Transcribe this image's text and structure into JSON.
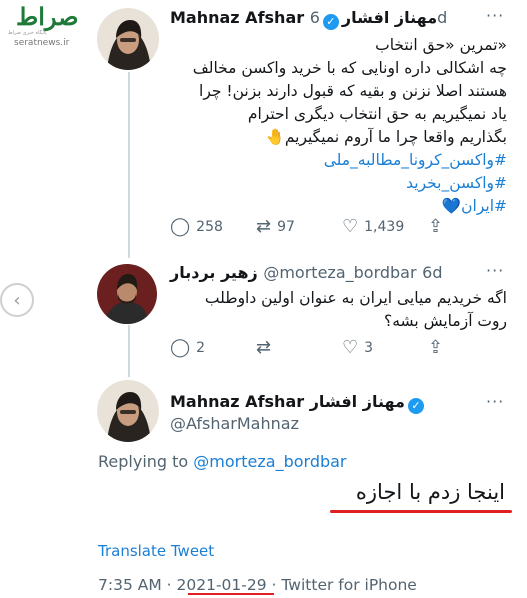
{
  "watermark": {
    "logo": "صراط",
    "tagline": "پایگاه خبری صراط",
    "site": "seratnews.ir"
  },
  "icons": {
    "prev": "chevron-left-icon",
    "reply": "reply-icon",
    "retweet": "retweet-icon",
    "like": "heart-icon",
    "share": "share-icon"
  },
  "colors": {
    "link": "#1b7fd4",
    "verified": "#1d9bf0",
    "highlight": "#e02020"
  },
  "tweet1": {
    "name_en": "Mahnaz Afshar",
    "name_fa": "مهناز افشار",
    "time": "6d",
    "lines": [
      "«تمرین «حق انتخاب",
      "چه اشکالی داره اونایی که با خرید واکسن مخالف",
      "هستند اصلا نزنن و بقیه که قبول دارند بزنن! چرا",
      "یاد نمیگیریم به حق انتخاب دیگری احترام",
      "بگذاریم واقعا چرا ما آروم نمیگیریم🤚"
    ],
    "hashtags": [
      "#واکسن_کرونا_مطالبه_ملی",
      "#واکسن_بخرید",
      "#ایران💙"
    ],
    "replies": "258",
    "retweets": "97",
    "likes": "1,439"
  },
  "tweet2": {
    "name_fa": "زهیر بردبار",
    "handle": "@morteza_bordbar",
    "time": "6d",
    "lines": [
      "اگه خریدیم میایی ایران به عنوان اولین داوطلب",
      "روت آزمایش بشه؟"
    ],
    "replies": "2",
    "likes": "3"
  },
  "tweet3": {
    "name_en": "Mahnaz Afshar",
    "name_fa": "مهناز افشار",
    "handle": "@AfsharMahnaz",
    "replying_prefix": "Replying to",
    "replying_handle": "@morteza_bordbar",
    "text": "اینجا زدم با اجازه",
    "translate": "Translate Tweet",
    "time": "7:35 AM",
    "date": "2021-01-29",
    "source": "Twitter for iPhone"
  }
}
